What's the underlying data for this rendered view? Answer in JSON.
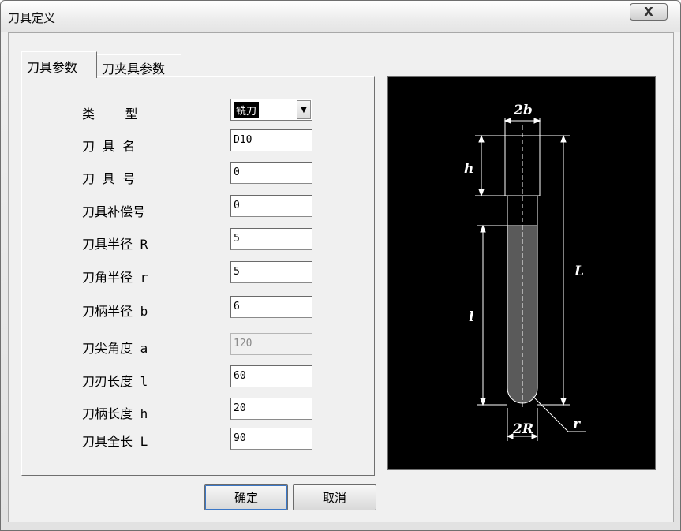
{
  "window": {
    "title": "刀具定义",
    "close_symbol": "X"
  },
  "tabs": [
    {
      "label": "刀具参数",
      "active": true
    },
    {
      "label": "刀夹具参数",
      "active": false
    }
  ],
  "form": {
    "type_label": "类    型",
    "type_value": "铣刀",
    "name_label": "刀 具 名",
    "name_value": "D10",
    "number_label": "刀 具 号",
    "number_value": "0",
    "comp_label": "刀具补偿号",
    "comp_value": "0",
    "radius_label": "刀具半径 R",
    "radius_value": "5",
    "corner_label": "刀角半径 r",
    "corner_value": "5",
    "shank_radius_label": "刀柄半径 b",
    "shank_radius_value": "6",
    "tip_angle_label": "刀尖角度 a",
    "tip_angle_value": "120",
    "flute_len_label": "刀刃长度 l",
    "flute_len_value": "60",
    "shank_len_label": "刀柄长度 h",
    "shank_len_value": "20",
    "total_len_label": "刀具全长 L",
    "total_len_value": "90"
  },
  "buttons": {
    "ok": "确定",
    "cancel": "取消"
  },
  "diagram": {
    "dim_2b": "2b",
    "dim_h": "h",
    "dim_L": "L",
    "dim_l": "l",
    "dim_2R": "2R",
    "dim_r": "r"
  },
  "colors": {
    "preview_bg": "#000000",
    "preview_line": "#ffffff",
    "flute_fill": "#5a5a5a"
  }
}
